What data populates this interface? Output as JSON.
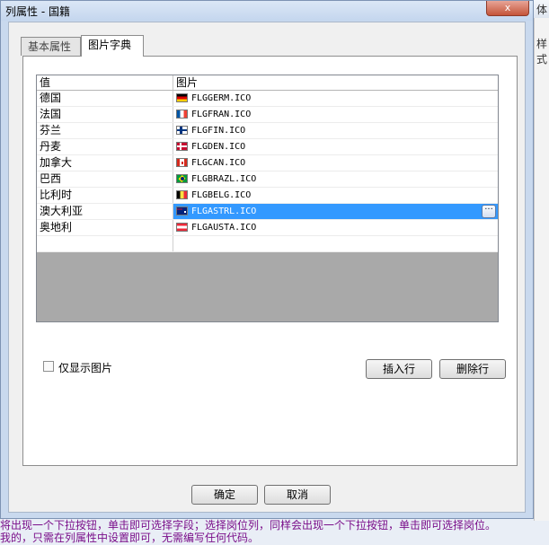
{
  "window": {
    "title": "列属性 - 国籍",
    "close_symbol": "x"
  },
  "background": {
    "right_panel_label_top": "体",
    "right_panel_label": "样式",
    "bottom_text_line1": "将出现一个下拉按钮，单击即可选择字段；选择岗位列，同样会出现一个下拉按钮，单击即可选择岗位。",
    "bottom_text_line2": "我的，只需在列属性中设置即可，无需编写任何代码。"
  },
  "tabs": [
    {
      "label": "基本属性",
      "active": false
    },
    {
      "label": "图片字典",
      "active": true
    }
  ],
  "grid": {
    "columns": [
      "值",
      "图片"
    ],
    "rows": [
      {
        "value": "德国",
        "image": "FLGGERM.ICO",
        "flag": "germany-flag-icon"
      },
      {
        "value": "法国",
        "image": "FLGFRAN.ICO",
        "flag": "france-flag-icon"
      },
      {
        "value": "芬兰",
        "image": "FLGFIN.ICO",
        "flag": "finland-flag-icon"
      },
      {
        "value": "丹麦",
        "image": "FLGDEN.ICO",
        "flag": "denmark-flag-icon"
      },
      {
        "value": "加拿大",
        "image": "FLGCAN.ICO",
        "flag": "canada-flag-icon"
      },
      {
        "value": "巴西",
        "image": "FLGBRAZL.ICO",
        "flag": "brazil-flag-icon"
      },
      {
        "value": "比利时",
        "image": "FLGBELG.ICO",
        "flag": "belgium-flag-icon"
      },
      {
        "value": "澳大利亚",
        "image": "FLGASTRL.ICO",
        "flag": "australia-flag-icon",
        "selected": true
      },
      {
        "value": "奥地利",
        "image": "FLGAUSTA.ICO",
        "flag": "austria-flag-icon"
      }
    ],
    "ellipsis_label": "···",
    "selection_color": "#3399ff"
  },
  "options": {
    "show_image_only_label": "仅显示图片",
    "show_image_only_checked": false
  },
  "buttons": {
    "insert_row": "插入行",
    "delete_row": "删除行",
    "ok": "确定",
    "cancel": "取消"
  }
}
